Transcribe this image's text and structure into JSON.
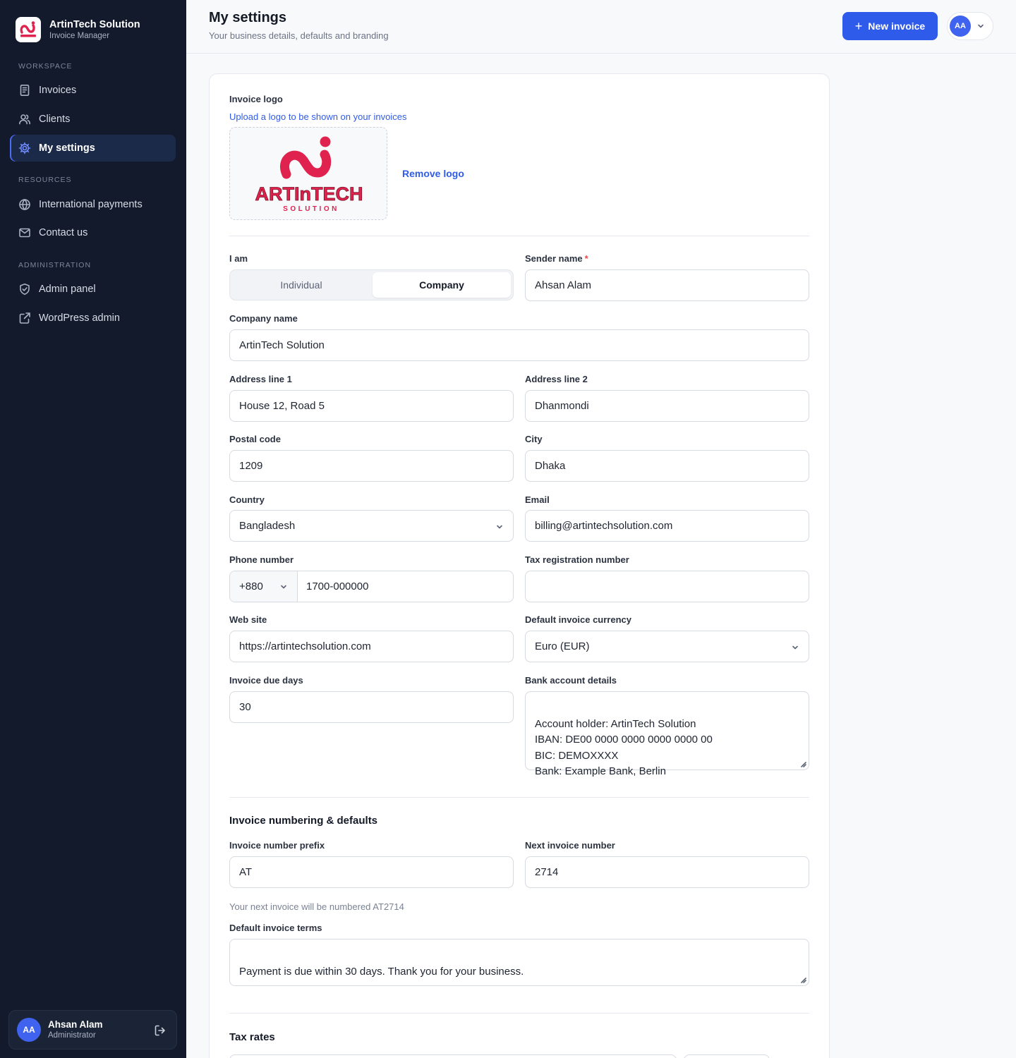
{
  "brand": {
    "title": "ArtinTech Solution",
    "subtitle": "Invoice Manager",
    "logo_icon": "artintech-logo-icon"
  },
  "sidebar": {
    "sections": [
      {
        "label": "WORKSPACE"
      },
      {
        "label": "RESOURCES"
      },
      {
        "label": "ADMINISTRATION"
      }
    ],
    "items": [
      {
        "label": "Invoices",
        "icon": "document-icon"
      },
      {
        "label": "Clients",
        "icon": "users-icon"
      },
      {
        "label": "My settings",
        "icon": "gear-icon",
        "active": true
      },
      {
        "label": "International payments",
        "icon": "globe-icon"
      },
      {
        "label": "Contact us",
        "icon": "mail-icon"
      },
      {
        "label": "Admin panel",
        "icon": "shield-icon"
      },
      {
        "label": "WordPress admin",
        "icon": "external-link-icon"
      }
    ],
    "user": {
      "initials": "AA",
      "name": "Ahsan Alam",
      "role": "Administrator"
    }
  },
  "header": {
    "title": "My settings",
    "subtitle": "Your business details, defaults and branding",
    "new_invoice_label": "New invoice",
    "user_initials": "AA"
  },
  "form": {
    "logo": {
      "label": "Invoice logo",
      "help": "Upload a logo to be shown on your invoices",
      "remove_label": "Remove logo",
      "logo_text_main": "ARTInTECH",
      "logo_text_sub": "SOLUTION"
    },
    "i_am": {
      "label": "I am",
      "options": [
        "Individual",
        "Company"
      ],
      "selected": "Company"
    },
    "sender_name": {
      "label": "Sender name",
      "required_mark": "*",
      "value": "Ahsan Alam"
    },
    "company_name": {
      "label": "Company name",
      "value": "ArtinTech Solution"
    },
    "address1": {
      "label": "Address line 1",
      "value": "House 12, Road 5"
    },
    "address2": {
      "label": "Address line 2",
      "value": "Dhanmondi"
    },
    "postal_code": {
      "label": "Postal code",
      "value": "1209"
    },
    "city": {
      "label": "City",
      "value": "Dhaka"
    },
    "country": {
      "label": "Country",
      "value": "Bangladesh"
    },
    "email": {
      "label": "Email",
      "value": "billing@artintechsolution.com"
    },
    "phone": {
      "label": "Phone number",
      "code": "+880",
      "value": "1700-000000"
    },
    "tax_reg": {
      "label": "Tax registration number",
      "value": ""
    },
    "website": {
      "label": "Web site",
      "value": "https://artintechsolution.com"
    },
    "currency": {
      "label": "Default invoice currency",
      "value": "Euro (EUR)"
    },
    "due_days": {
      "label": "Invoice due days",
      "value": "30"
    },
    "bank": {
      "label": "Bank account details",
      "value": "Account holder: ArtinTech Solution\nIBAN: DE00 0000 0000 0000 0000 00\nBIC: DEMOXXXX\nBank: Example Bank, Berlin"
    }
  },
  "numbering": {
    "title": "Invoice numbering & defaults",
    "prefix": {
      "label": "Invoice number prefix",
      "value": "AT"
    },
    "next_number": {
      "label": "Next invoice number",
      "value": "2714"
    },
    "hint": "Your next invoice will be numbered AT2714",
    "terms": {
      "label": "Default invoice terms",
      "value": "Payment is due within 30 days. Thank you for your business."
    }
  },
  "tax": {
    "title": "Tax rates"
  },
  "colors": {
    "sidebar_bg": "#121a2c",
    "accent": "#2f5bea",
    "logo_red": "#e0234e"
  }
}
